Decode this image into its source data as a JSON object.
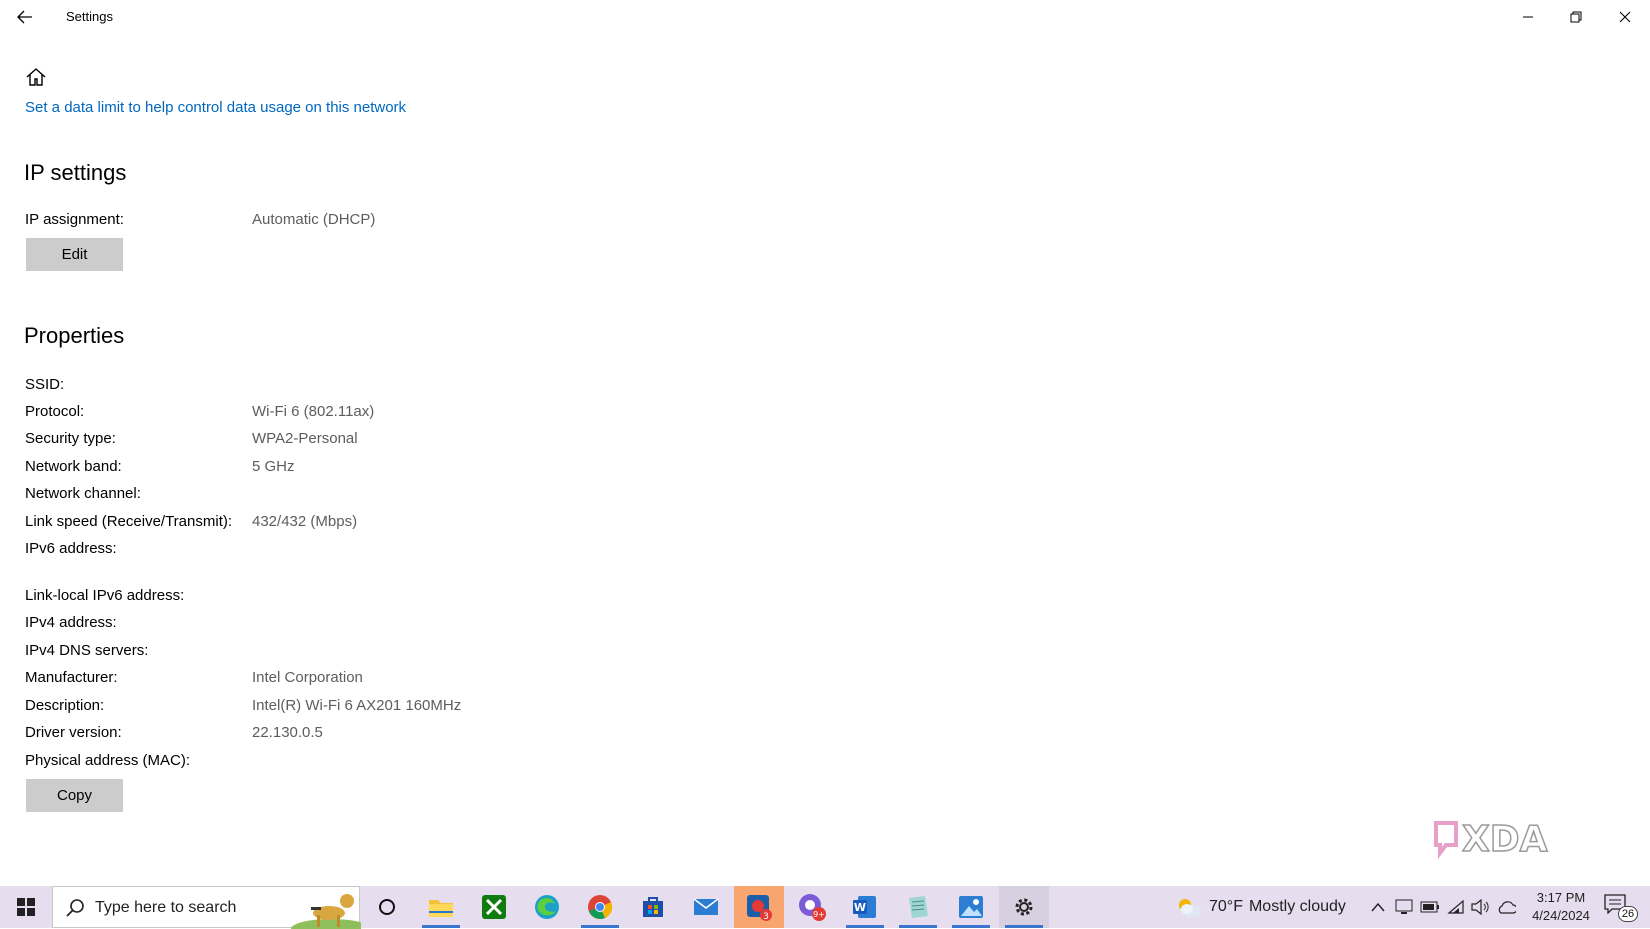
{
  "window": {
    "title": "Settings"
  },
  "content": {
    "data_limit_link": "Set a data limit to help control data usage on this network",
    "ip_settings": {
      "title": "IP settings",
      "assignment_label": "IP assignment:",
      "assignment_value": "Automatic (DHCP)",
      "edit_label": "Edit"
    },
    "properties": {
      "title": "Properties",
      "rows": [
        {
          "label": "SSID:",
          "value": ""
        },
        {
          "label": "Protocol:",
          "value": "Wi-Fi 6 (802.11ax)"
        },
        {
          "label": "Security type:",
          "value": "WPA2-Personal"
        },
        {
          "label": "Network band:",
          "value": "5 GHz"
        },
        {
          "label": "Network channel:",
          "value": ""
        },
        {
          "label": "Link speed (Receive/Transmit):",
          "value": "432/432 (Mbps)"
        },
        {
          "label": "IPv6 address:",
          "value": ""
        },
        {
          "label": "Link-local IPv6 address:",
          "value": ""
        },
        {
          "label": "IPv4 address:",
          "value": ""
        },
        {
          "label": "IPv4 DNS servers:",
          "value": ""
        },
        {
          "label": "Manufacturer:",
          "value": "Intel Corporation"
        },
        {
          "label": "Description:",
          "value": "Intel(R) Wi-Fi 6 AX201 160MHz"
        },
        {
          "label": "Driver version:",
          "value": "22.130.0.5"
        },
        {
          "label": "Physical address (MAC):",
          "value": ""
        }
      ],
      "copy_label": "Copy"
    }
  },
  "watermark": "XDA",
  "taskbar": {
    "search_placeholder": "Type here to search",
    "apps": [
      "task-view",
      "file-explorer",
      "xbox",
      "edge",
      "chrome",
      "microsoft-store",
      "mail",
      "news-app",
      "chat-app",
      "word",
      "notepad-app",
      "photos",
      "settings"
    ],
    "weather_temp": "70°F",
    "weather_desc": "Mostly cloudy",
    "time": "3:17 PM",
    "date": "4/24/2024",
    "notification_count": "26",
    "badge_news": "3",
    "badge_chat": "9+"
  }
}
